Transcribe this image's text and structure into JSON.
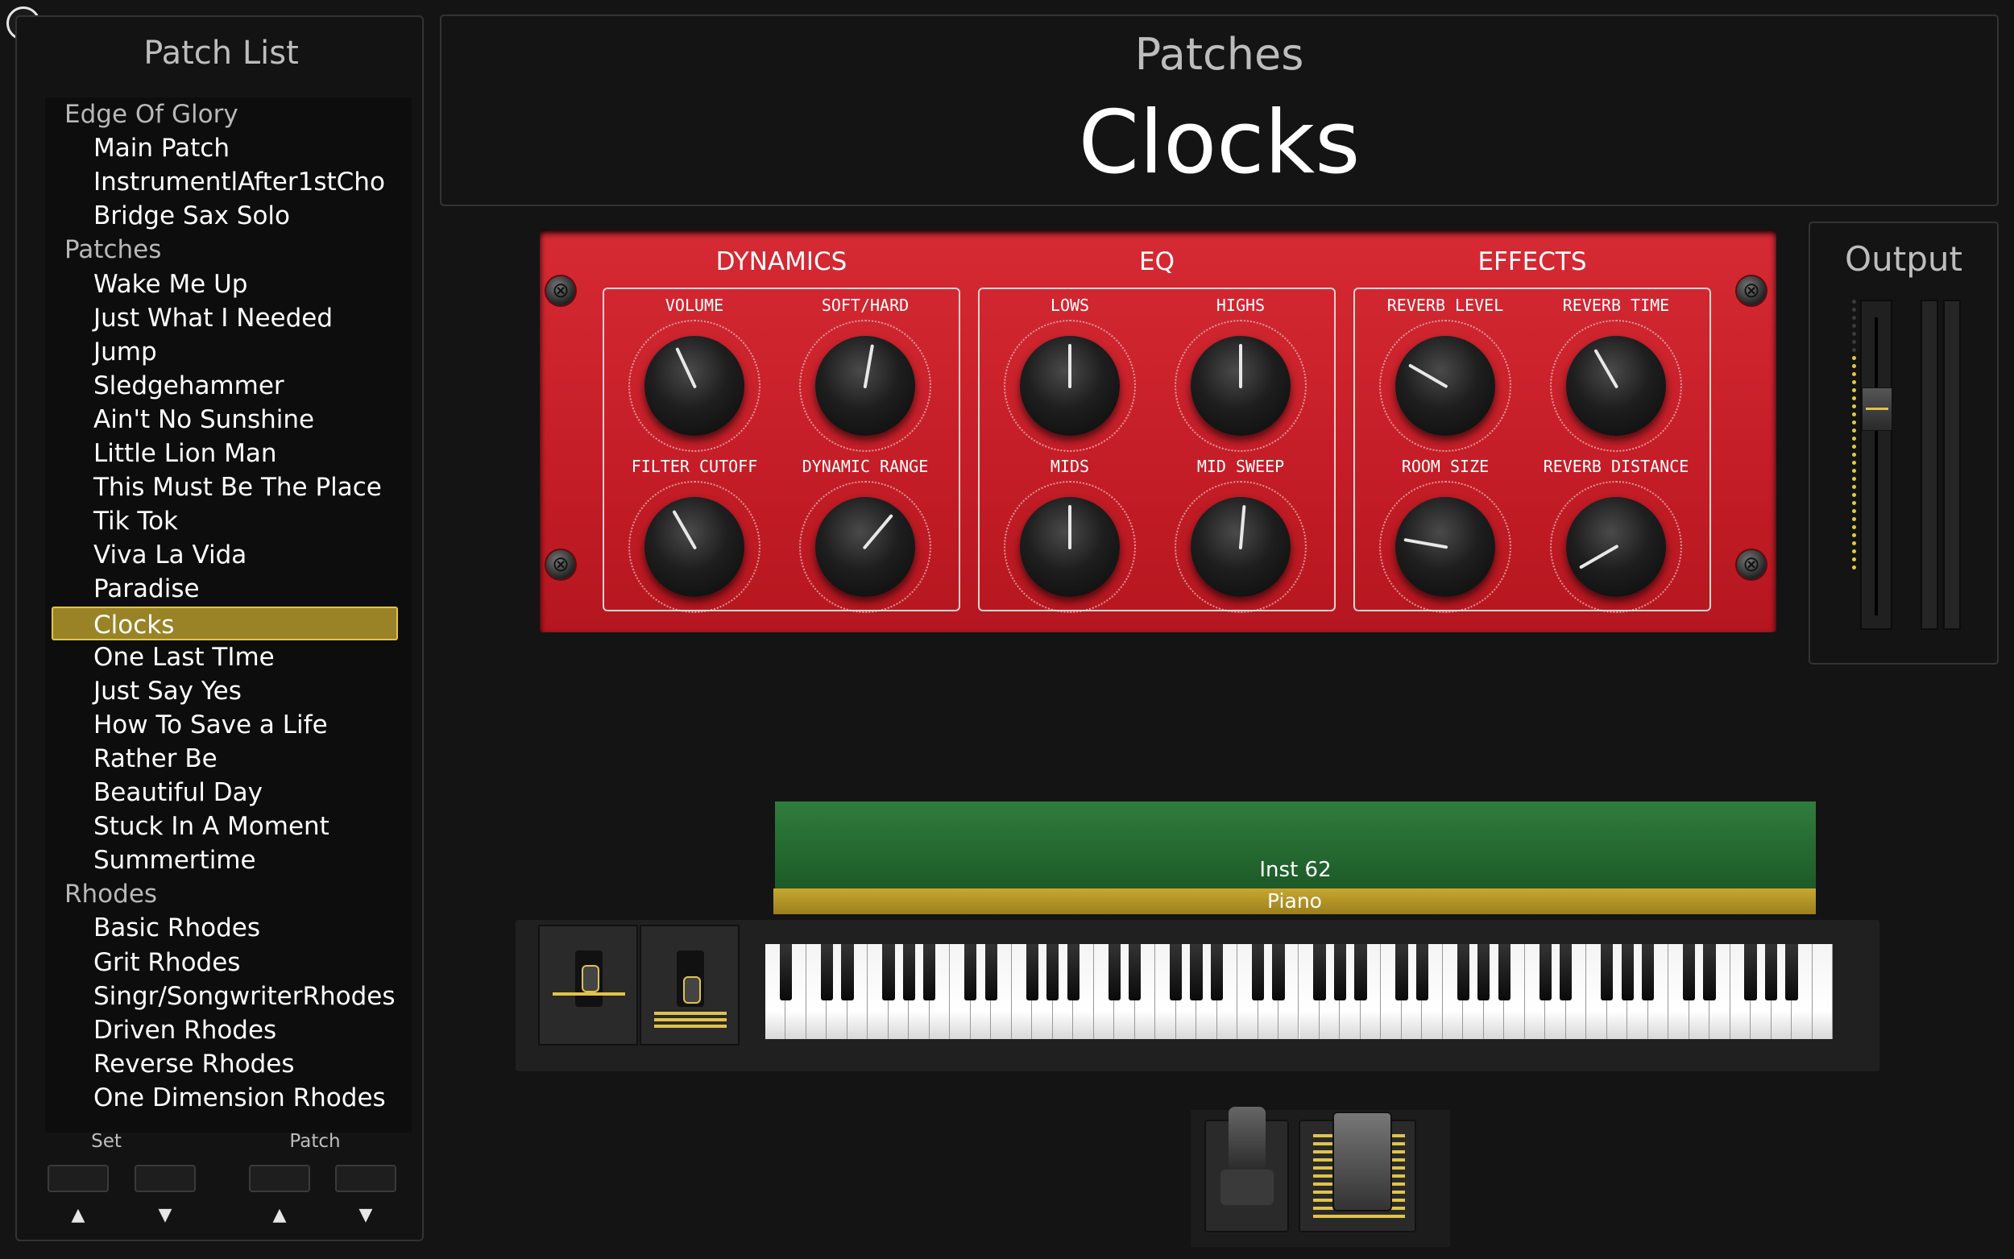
{
  "window": {
    "close_icon": "close-icon"
  },
  "patch_list": {
    "title": "Patch List",
    "rows": [
      {
        "type": "set",
        "label": "Edge Of Glory"
      },
      {
        "type": "patch",
        "label": "Main Patch"
      },
      {
        "type": "patch",
        "label": "InstrumentlAfter1stCho"
      },
      {
        "type": "patch",
        "label": "Bridge Sax Solo"
      },
      {
        "type": "set",
        "label": "Patches"
      },
      {
        "type": "patch",
        "label": "Wake Me Up"
      },
      {
        "type": "patch",
        "label": "Just What I Needed"
      },
      {
        "type": "patch",
        "label": "Jump"
      },
      {
        "type": "patch",
        "label": "Sledgehammer"
      },
      {
        "type": "patch",
        "label": "Ain't No Sunshine"
      },
      {
        "type": "patch",
        "label": "Little Lion Man"
      },
      {
        "type": "patch",
        "label": "This Must Be The Place"
      },
      {
        "type": "patch",
        "label": "Tik Tok"
      },
      {
        "type": "patch",
        "label": "Viva La Vida"
      },
      {
        "type": "patch",
        "label": "Paradise"
      },
      {
        "type": "patch",
        "label": "Clocks",
        "selected": true
      },
      {
        "type": "patch",
        "label": "One Last TIme"
      },
      {
        "type": "patch",
        "label": "Just Say Yes"
      },
      {
        "type": "patch",
        "label": "How To Save a Life"
      },
      {
        "type": "patch",
        "label": "Rather Be"
      },
      {
        "type": "patch",
        "label": "Beautiful Day"
      },
      {
        "type": "patch",
        "label": "Stuck In A Moment"
      },
      {
        "type": "patch",
        "label": "Summertime"
      },
      {
        "type": "set",
        "label": "Rhodes"
      },
      {
        "type": "patch",
        "label": "Basic Rhodes"
      },
      {
        "type": "patch",
        "label": "Grit Rhodes"
      },
      {
        "type": "patch",
        "label": "Singr/SongwriterRhodes"
      },
      {
        "type": "patch",
        "label": "Driven Rhodes"
      },
      {
        "type": "patch",
        "label": "Reverse Rhodes"
      },
      {
        "type": "patch",
        "label": "One Dimension Rhodes"
      }
    ],
    "controls": {
      "set_label": "Set",
      "patch_label": "Patch",
      "up_arrow": "▲",
      "down_arrow": "▼"
    }
  },
  "header": {
    "subtitle": "Patches",
    "title": "Clocks"
  },
  "smart_controls": {
    "accent_color": "#c8212b",
    "sections": [
      {
        "title": "DYNAMICS",
        "knobs": [
          {
            "label": "VOLUME",
            "value": -25
          },
          {
            "label": "SOFT/HARD",
            "value": 10
          },
          {
            "label": "FILTER CUTOFF",
            "value": -30
          },
          {
            "label": "DYNAMIC RANGE",
            "value": 40
          }
        ]
      },
      {
        "title": "EQ",
        "knobs": [
          {
            "label": "LOWS",
            "value": 0
          },
          {
            "label": "HIGHS",
            "value": 0
          },
          {
            "label": "MIDS",
            "value": 0
          },
          {
            "label": "MID SWEEP",
            "value": 5
          }
        ]
      },
      {
        "title": "EFFECTS",
        "knobs": [
          {
            "label": "REVERB LEVEL",
            "value": -60
          },
          {
            "label": "REVERB TIME",
            "value": -30
          },
          {
            "label": "ROOM SIZE",
            "value": -80
          },
          {
            "label": "REVERB DISTANCE",
            "value": -120
          }
        ]
      }
    ]
  },
  "output": {
    "title": "Output",
    "level": 0.68
  },
  "instrument": {
    "name": "Inst 62",
    "type": "Piano",
    "name_color": "#2f7d3c",
    "type_color": "#c7a731"
  }
}
